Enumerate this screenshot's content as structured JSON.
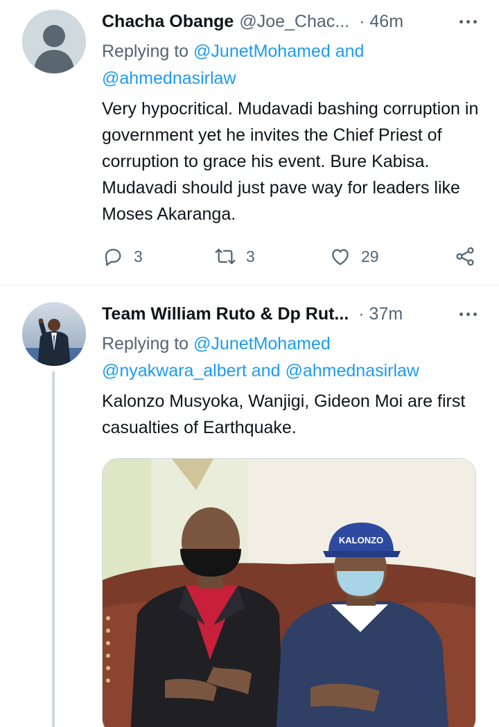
{
  "tweets": [
    {
      "name": "Chacha Obange",
      "handle": "@Joe_Chac...",
      "time": "· 46m",
      "replying_prefix": "Replying to ",
      "mention_1": "@JunetMohamed",
      "joiner_1": " and",
      "mention_2": "@ahmednasirlaw",
      "text": "Very hypocritical. Mudavadi bashing corruption in government yet he invites the Chief Priest of corruption to grace his event. Bure Kabisa. Mudavadi should just pave way for leaders like Moses Akaranga.",
      "replies": "3",
      "retweets": "3",
      "likes": "29"
    },
    {
      "name": "Team William Ruto & Dp Rut...",
      "time": "· 37m",
      "replying_prefix": "Replying to ",
      "mention_1": "@JunetMohamed",
      "mention_2": "@nyakwara_albert",
      "joiner_2": " and ",
      "mention_3": "@ahmednasirlaw",
      "text": "Kalonzo Musyoka, Wanjigi, Gideon Moi are first casualties of Earthquake.",
      "cap_text": "KALONZO"
    }
  ],
  "colors": {
    "link": "#1d9bf0",
    "secondary_text": "#536471",
    "primary_text": "#0f1419",
    "divider": "#e6ecf0"
  },
  "icons": [
    "default-avatar-icon",
    "more-icon",
    "reply-icon",
    "retweet-icon",
    "like-icon",
    "share-icon"
  ]
}
